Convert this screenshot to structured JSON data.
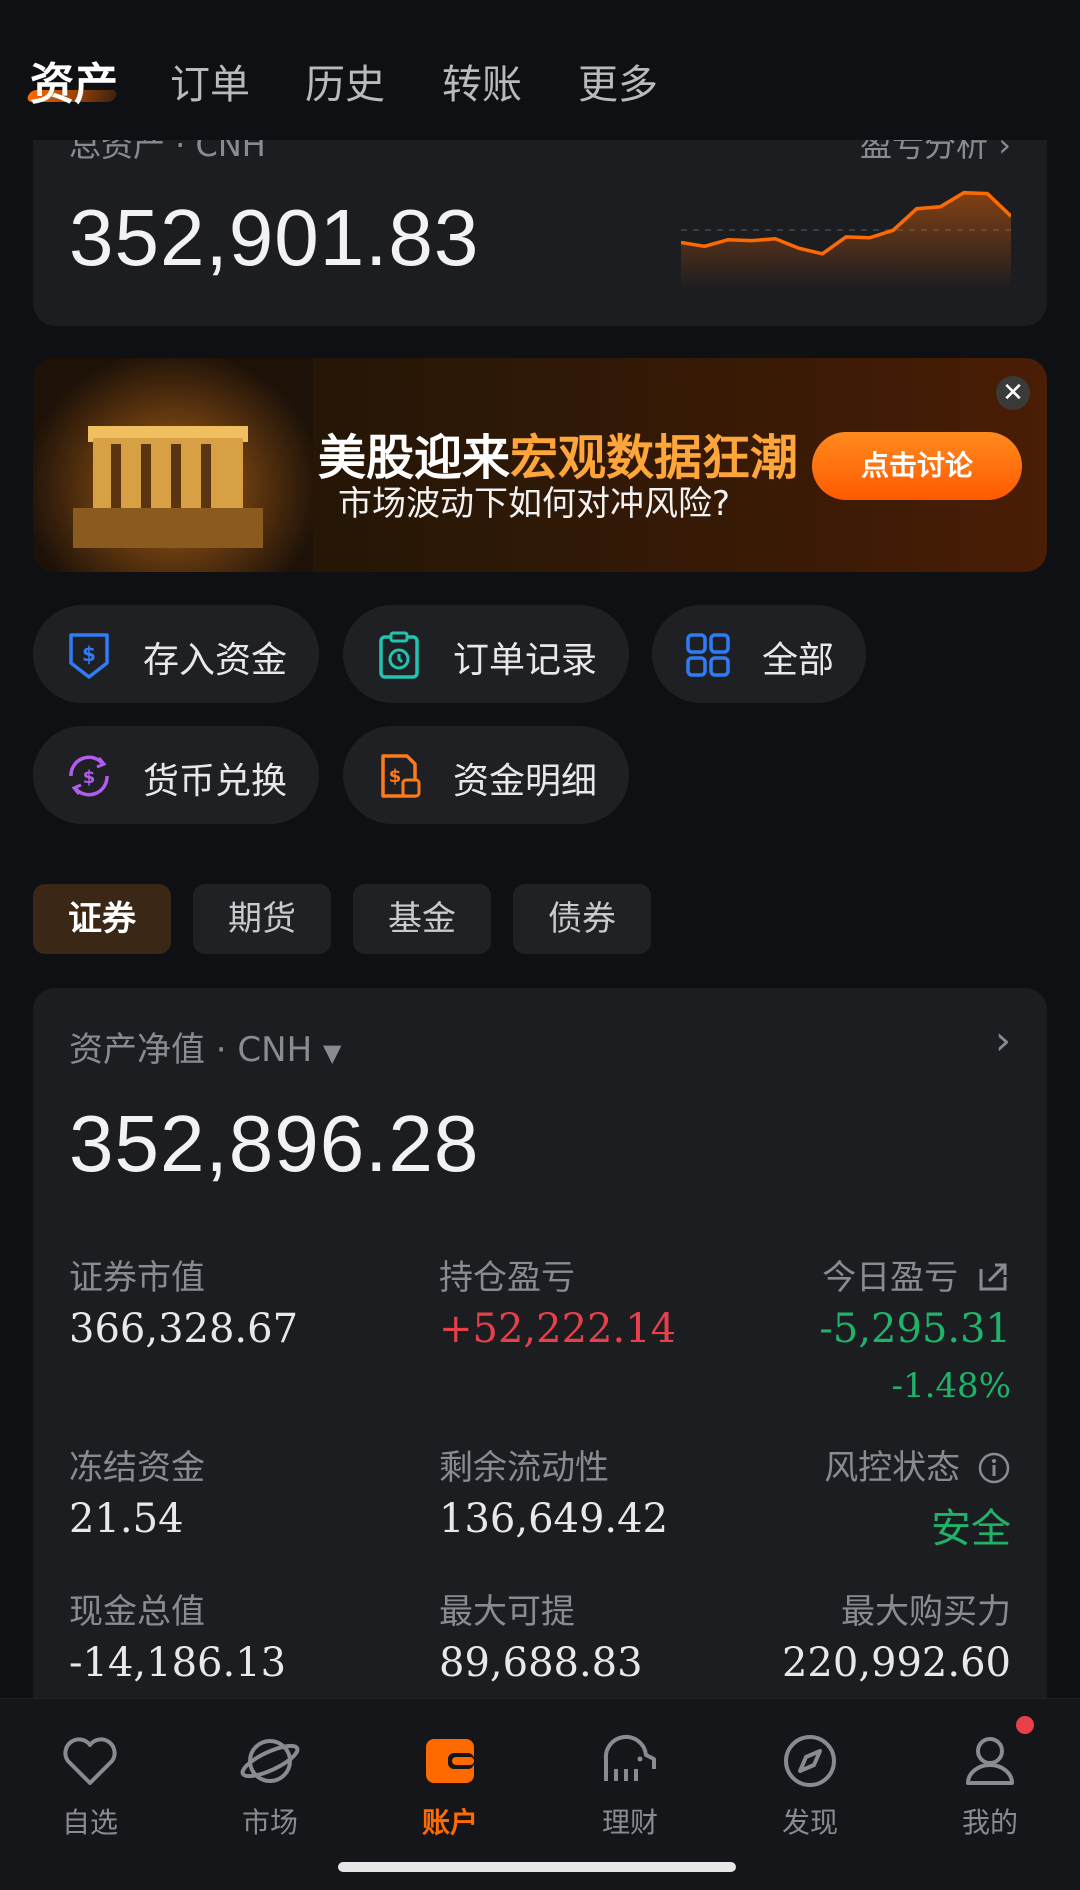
{
  "top_tabs": [
    "资产",
    "订单",
    "历史",
    "转账",
    "更多"
  ],
  "total_assets": {
    "label": "总资产 · CNH",
    "pl_link": "盈亏分析",
    "value": "352,901.83",
    "sparkline": [
      0.42,
      0.38,
      0.45,
      0.44,
      0.46,
      0.36,
      0.3,
      0.48,
      0.47,
      0.55,
      0.78,
      0.8,
      0.95,
      0.94,
      0.7
    ]
  },
  "banner": {
    "title_part1": "美股迎来",
    "title_part2": "宏观数据狂潮",
    "subtitle": "市场波动下如何对冲风险?",
    "button": "点击讨论",
    "close": "✕"
  },
  "quick_actions": [
    {
      "label": "存入资金",
      "icon": "deposit-icon",
      "color": "#2f7cf6"
    },
    {
      "label": "订单记录",
      "icon": "order-record-icon",
      "color": "#22c3b0"
    },
    {
      "label": "全部",
      "icon": "grid-icon",
      "color": "#2f7cf6"
    },
    {
      "label": "货币兑换",
      "icon": "currency-exchange-icon",
      "color": "#b35cf0"
    },
    {
      "label": "资金明细",
      "icon": "fund-detail-icon",
      "color": "#ff7a1a"
    }
  ],
  "segments": [
    "证券",
    "期货",
    "基金",
    "债券"
  ],
  "net_assets": {
    "label": "资产净值 · CNH",
    "value": "352,896.28",
    "stats": {
      "market_value_label": "证券市值",
      "market_value": "366,328.67",
      "position_pl_label": "持仓盈亏",
      "position_pl": "+52,222.14",
      "today_pl_label": "今日盈亏",
      "today_pl": "-5,295.31",
      "today_pl_pct": "-1.48%",
      "frozen_label": "冻结资金",
      "frozen": "21.54",
      "liquidity_label": "剩余流动性",
      "liquidity": "136,649.42",
      "risk_label": "风控状态",
      "risk": "安全",
      "cash_label": "现金总值",
      "cash": "-14,186.13",
      "max_withdraw_label": "最大可提",
      "max_withdraw": "89,688.83",
      "max_buying_label": "最大购买力",
      "max_buying": "220,992.60"
    }
  },
  "bottom_nav": [
    {
      "label": "自选",
      "icon": "heart-icon"
    },
    {
      "label": "市场",
      "icon": "planet-icon"
    },
    {
      "label": "账户",
      "icon": "wallet-icon"
    },
    {
      "label": "理财",
      "icon": "elephant-icon"
    },
    {
      "label": "发现",
      "icon": "compass-icon"
    },
    {
      "label": "我的",
      "icon": "user-icon"
    }
  ],
  "colors": {
    "accent": "#ff6a00",
    "gain": "#e8404a",
    "loss": "#1fb36a"
  }
}
